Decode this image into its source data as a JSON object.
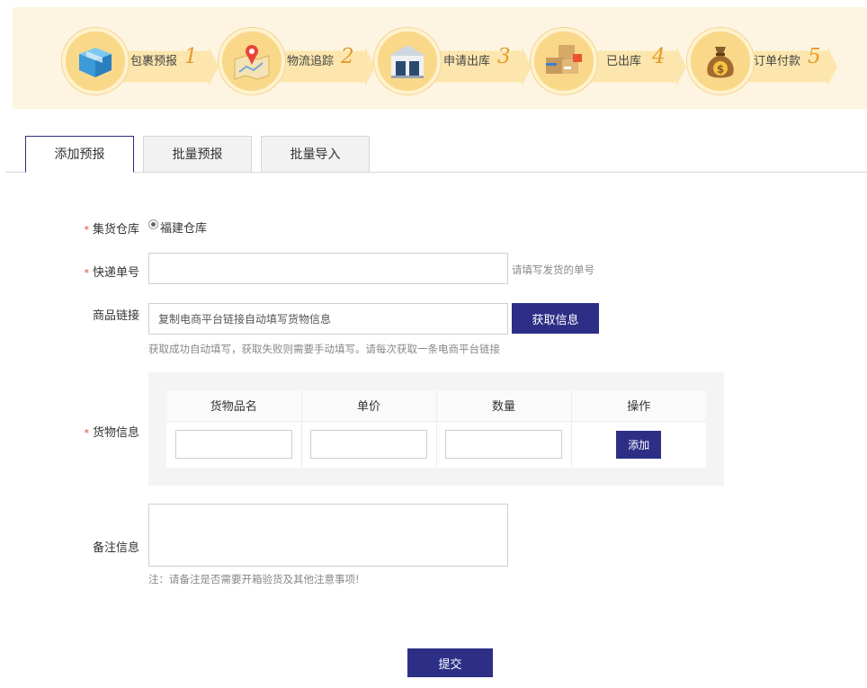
{
  "steps": [
    {
      "label": "包裹预报",
      "num": "1",
      "icon": "box-icon"
    },
    {
      "label": "物流追踪",
      "num": "2",
      "icon": "map-pin-icon"
    },
    {
      "label": "申请出库",
      "num": "3",
      "icon": "warehouse-icon"
    },
    {
      "label": "已出库",
      "num": "4",
      "icon": "shipped-boxes-icon"
    },
    {
      "label": "订单付款",
      "num": "5",
      "icon": "money-bag-icon"
    }
  ],
  "tabs": [
    {
      "label": "添加预报",
      "active": true
    },
    {
      "label": "批量预报",
      "active": false
    },
    {
      "label": "批量导入",
      "active": false
    }
  ],
  "form": {
    "required_mark": "*",
    "warehouse": {
      "label": "集货仓库",
      "option": "福建仓库",
      "selected": true
    },
    "tracking": {
      "label": "快递单号",
      "value": "",
      "hint": "请填写发货的单号"
    },
    "product_link": {
      "label": "商品链接",
      "placeholder": "复制电商平台链接自动填写货物信息",
      "button": "获取信息",
      "hint": "获取成功自动填写，获取失败则需要手动填写。请每次获取一条电商平台链接"
    },
    "goods": {
      "label": "货物信息",
      "columns": [
        "货物品名",
        "单价",
        "数量",
        "操作"
      ],
      "add_button": "添加"
    },
    "remark": {
      "label": "备注信息",
      "value": "",
      "hint": "注：请备注是否需要开箱验货及其他注意事项!"
    },
    "submit": "提交"
  },
  "colors": {
    "accent": "#2d2f87",
    "banner_bg": "#fdf4e2",
    "ribbon": "#fce6ae",
    "step_number": "#e79a2a",
    "required": "#d9443c"
  }
}
